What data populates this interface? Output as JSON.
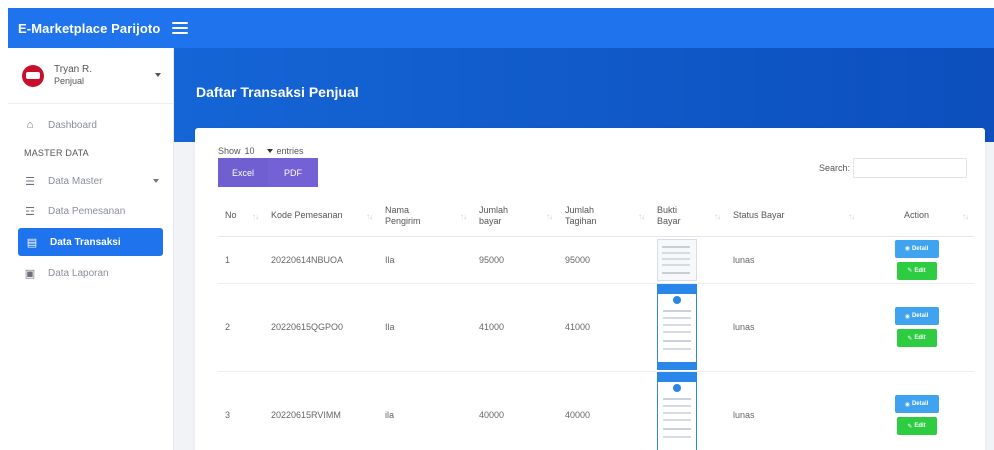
{
  "brand": "E-Marketplace Parijoto",
  "user": {
    "name": "Tryan R.",
    "role": "Penjual"
  },
  "sidebar": {
    "dashboard": "Dashboard",
    "section": "MASTER DATA",
    "items": [
      {
        "label": "Data Master",
        "icon": "database-icon"
      },
      {
        "label": "Data Pemesanan",
        "icon": "cart-icon"
      },
      {
        "label": "Data Transaksi",
        "icon": "transaction-icon",
        "active": true
      },
      {
        "label": "Data Laporan",
        "icon": "report-icon"
      }
    ]
  },
  "page": {
    "title": "Daftar Transaksi Penjual"
  },
  "table_controls": {
    "show": "Show",
    "entries_value": "10",
    "entries": "entries",
    "excel": "Excel",
    "pdf": "PDF",
    "search_label": "Search:",
    "search_value": ""
  },
  "table": {
    "headers": {
      "no": "No",
      "kode": "Kode Pemesanan",
      "nama1": "Nama",
      "nama2": "Pengirim",
      "bayar1": "Jumlah",
      "bayar2": "bayar",
      "tagihan1": "Jumlah",
      "tagihan2": "Tagihan",
      "bukti1": "Bukti",
      "bukti2": "Bayar",
      "status": "Status Bayar",
      "action": "Action"
    },
    "rows": [
      {
        "no": "1",
        "kode": "20220614NBUOA",
        "nama": "Ila",
        "bayar": "95000",
        "tagihan": "95000",
        "status": "lunas"
      },
      {
        "no": "2",
        "kode": "20220615QGPO0",
        "nama": "Ila",
        "bayar": "41000",
        "tagihan": "41000",
        "status": "lunas"
      },
      {
        "no": "3",
        "kode": "20220615RVIMM",
        "nama": "ila",
        "bayar": "40000",
        "tagihan": "40000",
        "status": "lunas"
      }
    ],
    "detail_label": "Detail",
    "edit_label": "Edit"
  },
  "colors": {
    "primary": "#1f73ec",
    "export": "#6f5fd1",
    "detail": "#3fa3ef",
    "edit": "#2ecc40"
  }
}
